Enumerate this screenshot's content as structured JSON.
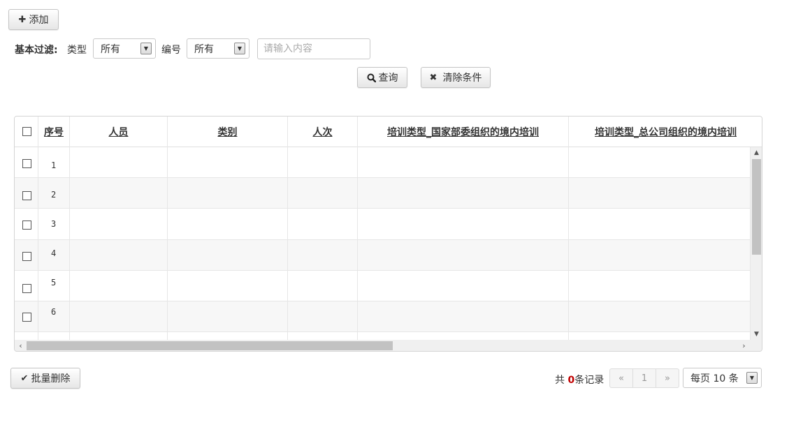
{
  "toolbar": {
    "add_label": "添加",
    "add_icon": "plus-icon"
  },
  "filter": {
    "label": "基本过滤:",
    "type_label": "类型",
    "type_value": "所有",
    "number_label": "编号",
    "number_value": "所有",
    "search_placeholder": "请输入内容"
  },
  "actions": {
    "query_label": "查询",
    "clear_label": "清除条件"
  },
  "table": {
    "columns": [
      "序号",
      "人员",
      "类别",
      "人次",
      "培训类型_国家部委组织的境内培训",
      "培训类型_总公司组织的境内培训"
    ],
    "rows": [
      {
        "seq": "1"
      },
      {
        "seq": "2"
      },
      {
        "seq": "3"
      },
      {
        "seq": "4"
      },
      {
        "seq": "5"
      },
      {
        "seq": "6"
      }
    ]
  },
  "footer": {
    "batch_delete_label": "批量删除",
    "total_prefix": "共",
    "total_count": "0",
    "total_suffix": "条记录",
    "prev": "«",
    "page": "1",
    "next": "»",
    "page_size_label": "每页 10 条"
  },
  "colors": {
    "count": "#c00000",
    "border": "#d4d4d4",
    "alt_row": "#f7f7f7"
  }
}
